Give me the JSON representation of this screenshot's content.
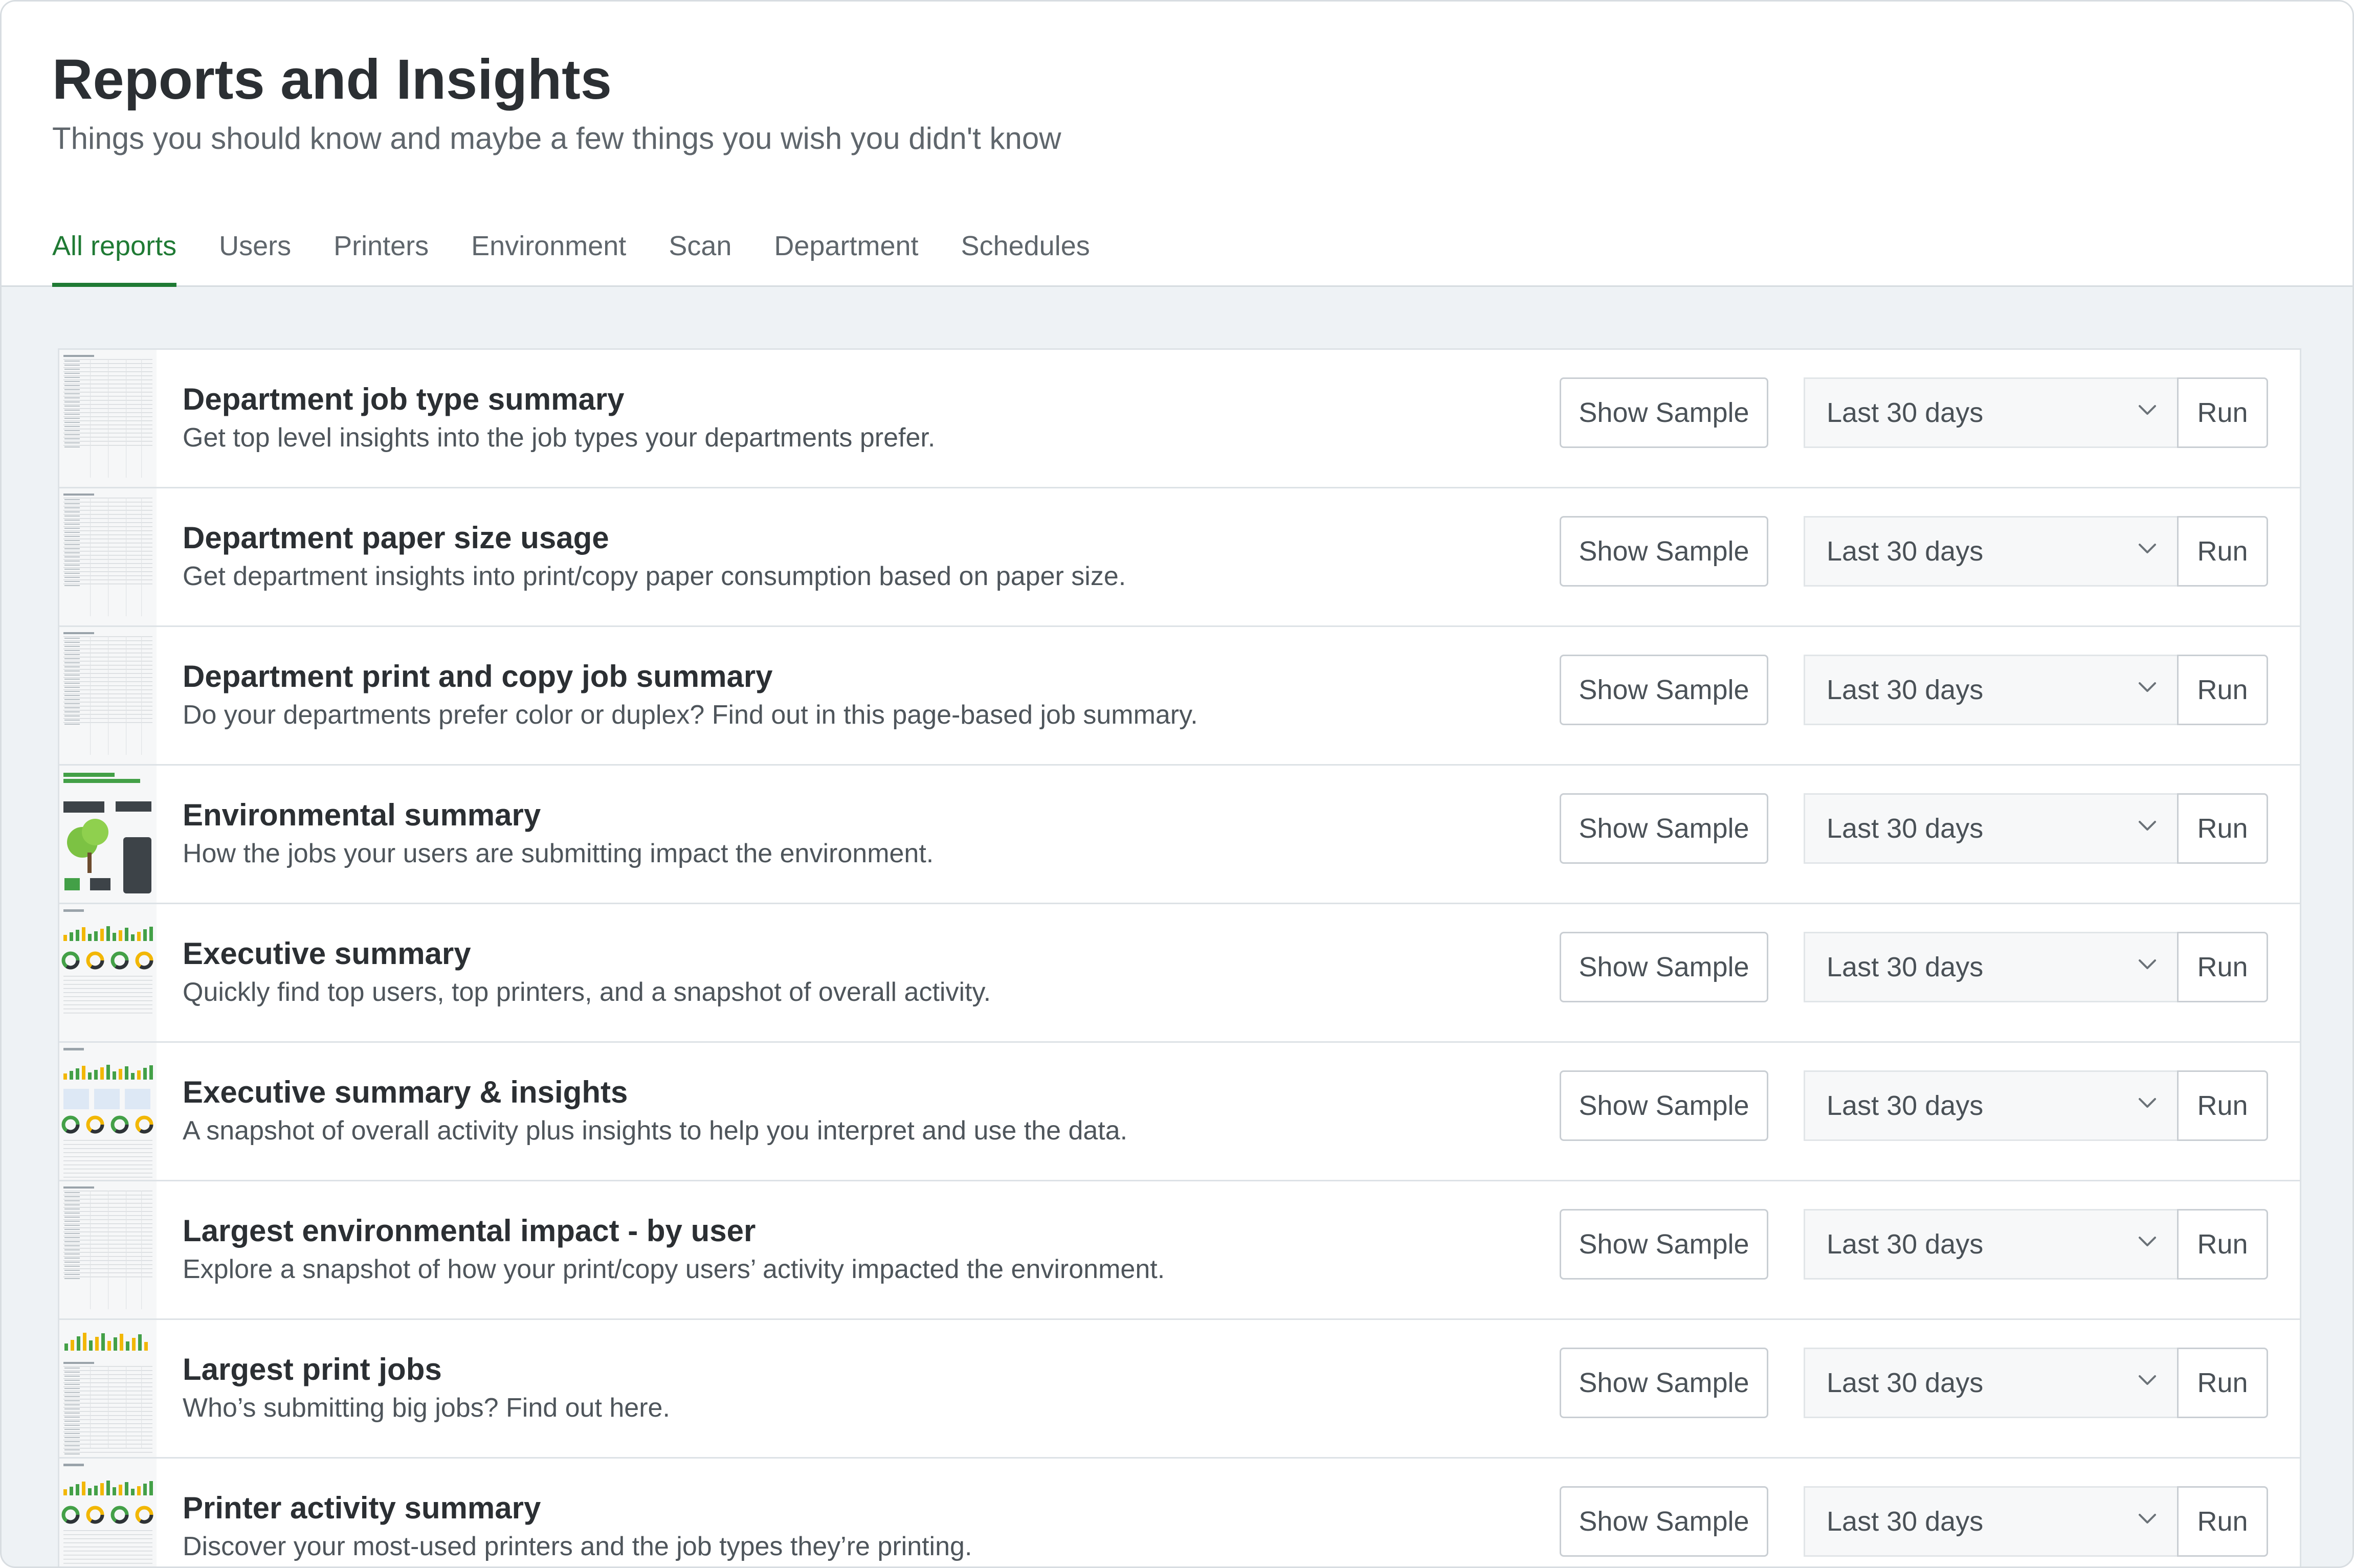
{
  "header": {
    "title": "Reports and Insights",
    "subtitle": "Things you should know and maybe a few things you wish you didn't know"
  },
  "tabs": [
    {
      "label": "All reports",
      "active": true
    },
    {
      "label": "Users",
      "active": false
    },
    {
      "label": "Printers",
      "active": false
    },
    {
      "label": "Environment",
      "active": false
    },
    {
      "label": "Scan",
      "active": false
    },
    {
      "label": "Department",
      "active": false
    },
    {
      "label": "Schedules",
      "active": false
    }
  ],
  "controls": {
    "show_sample_label": "Show Sample",
    "period_value": "Last 30 days",
    "run_label": "Run"
  },
  "reports": [
    {
      "title": "Department job type summary",
      "description": "Get top level insights into the job types your departments prefer.",
      "thumbnail": "table"
    },
    {
      "title": "Department paper size usage",
      "description": "Get department insights into print/copy paper consumption based on paper size.",
      "thumbnail": "table"
    },
    {
      "title": "Department print and copy job summary",
      "description": "Do your departments prefer color or duplex? Find out in this page-based job summary.",
      "thumbnail": "table"
    },
    {
      "title": "Environmental summary",
      "description": "How the jobs your users are submitting impact the environment.",
      "thumbnail": "environment"
    },
    {
      "title": "Executive summary",
      "description": "Quickly find top users, top printers, and a snapshot of overall activity.",
      "thumbnail": "charts"
    },
    {
      "title": "Executive summary & insights",
      "description": "A snapshot of overall activity plus insights to help you interpret and use the data.",
      "thumbnail": "charts-blue"
    },
    {
      "title": "Largest environmental impact - by user",
      "description": "Explore a snapshot of how your print/copy users’ activity impacted the environment.",
      "thumbnail": "table"
    },
    {
      "title": "Largest print jobs",
      "description": "Who’s submitting big jobs? Find out here.",
      "thumbnail": "bars-table"
    },
    {
      "title": "Printer activity summary",
      "description": "Discover your most-used printers and the job types they’re printing.",
      "thumbnail": "charts"
    }
  ],
  "colors": {
    "accent_green": "#1f7a34",
    "chart_green": "#43a047",
    "chart_yellow": "#f2b705"
  }
}
